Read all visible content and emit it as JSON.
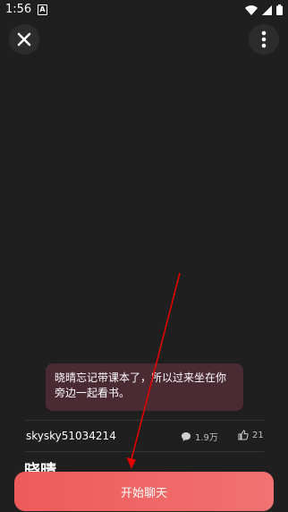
{
  "status_bar": {
    "time": "1:56",
    "notification_letter": "A"
  },
  "bubble": {
    "text": "晓晴忘记带课本了，所以过来坐在你旁边一起看书。"
  },
  "user_row": {
    "username": "skysky51034214",
    "comments": "1.9万",
    "likes": "21"
  },
  "character": {
    "title": "晓晴"
  },
  "actions": {
    "start_chat_label": "开始聊天"
  },
  "icons": {
    "close": "close-icon",
    "more": "more-vertical-icon",
    "comment": "comment-icon",
    "like": "thumb-up-icon"
  },
  "colors": {
    "background": "#1f1f1f",
    "bubble": "#4a2a33",
    "button": "#ef5a5a",
    "annotation_arrow": "#e00000"
  }
}
